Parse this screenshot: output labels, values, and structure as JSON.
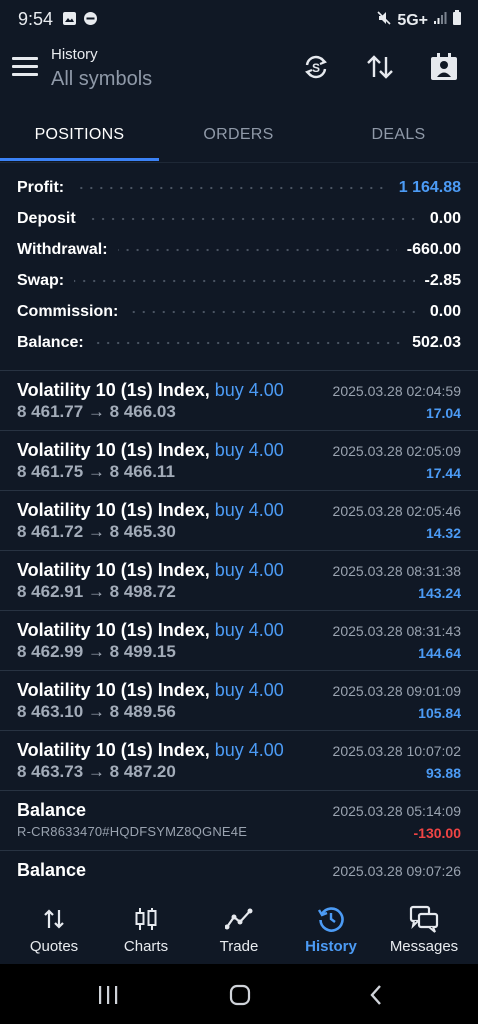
{
  "status_bar": {
    "time": "9:54",
    "network": "5G+"
  },
  "header": {
    "title": "History",
    "subtitle": "All symbols"
  },
  "tabs": [
    {
      "label": "POSITIONS",
      "active": true
    },
    {
      "label": "ORDERS",
      "active": false
    },
    {
      "label": "DEALS",
      "active": false
    }
  ],
  "summary": [
    {
      "label": "Profit:",
      "value": "1 164.88",
      "color": "#4c9bf5"
    },
    {
      "label": "Deposit",
      "value": "0.00"
    },
    {
      "label": "Withdrawal:",
      "value": "-660.00"
    },
    {
      "label": "Swap:",
      "value": "-2.85"
    },
    {
      "label": "Commission:",
      "value": "0.00"
    },
    {
      "label": "Balance:",
      "value": "502.03"
    }
  ],
  "deals": [
    {
      "symbol": "Volatility 10 (1s) Index,",
      "side": "buy 4.00",
      "open": "8 461.77",
      "close": "8 466.03",
      "time": "2025.03.28 02:04:59",
      "profit": "17.04"
    },
    {
      "symbol": "Volatility 10 (1s) Index,",
      "side": "buy 4.00",
      "open": "8 461.75",
      "close": "8 466.11",
      "time": "2025.03.28 02:05:09",
      "profit": "17.44"
    },
    {
      "symbol": "Volatility 10 (1s) Index,",
      "side": "buy 4.00",
      "open": "8 461.72",
      "close": "8 465.30",
      "time": "2025.03.28 02:05:46",
      "profit": "14.32"
    },
    {
      "symbol": "Volatility 10 (1s) Index,",
      "side": "buy 4.00",
      "open": "8 462.91",
      "close": "8 498.72",
      "time": "2025.03.28 08:31:38",
      "profit": "143.24"
    },
    {
      "symbol": "Volatility 10 (1s) Index,",
      "side": "buy 4.00",
      "open": "8 462.99",
      "close": "8 499.15",
      "time": "2025.03.28 08:31:43",
      "profit": "144.64"
    },
    {
      "symbol": "Volatility 10 (1s) Index,",
      "side": "buy 4.00",
      "open": "8 463.10",
      "close": "8 489.56",
      "time": "2025.03.28 09:01:09",
      "profit": "105.84"
    },
    {
      "symbol": "Volatility 10 (1s) Index,",
      "side": "buy 4.00",
      "open": "8 463.73",
      "close": "8 487.20",
      "time": "2025.03.28 10:07:02",
      "profit": "93.88"
    }
  ],
  "balance_ops": [
    {
      "label": "Balance",
      "comment": "R-CR8633470#HQDFSYMZ8QGNE4E",
      "time": "2025.03.28 05:14:09",
      "amount": "-130.00"
    },
    {
      "label": "Balance",
      "comment": "",
      "time": "2025.03.28 09:07:26",
      "amount": ""
    }
  ],
  "bottom_nav": [
    {
      "label": "Quotes",
      "icon": "quotes-arrows-icon",
      "active": false
    },
    {
      "label": "Charts",
      "icon": "candlestick-icon",
      "active": false
    },
    {
      "label": "Trade",
      "icon": "trend-line-icon",
      "active": false
    },
    {
      "label": "History",
      "icon": "clock-history-icon",
      "active": true
    },
    {
      "label": "Messages",
      "icon": "chat-bubbles-icon",
      "active": false
    }
  ],
  "colors": {
    "background": "#101825",
    "accent": "#4c9bf5",
    "negative": "#ef4444"
  }
}
